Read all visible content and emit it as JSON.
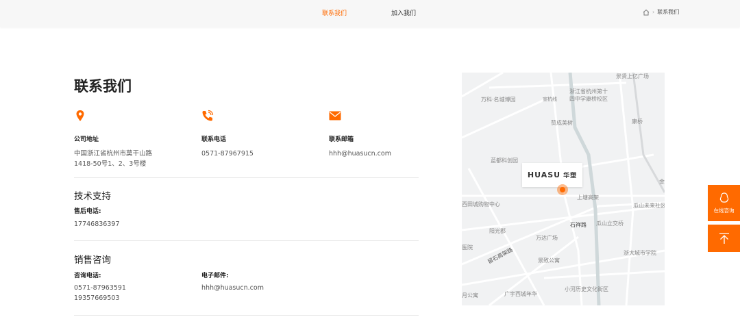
{
  "nav": {
    "tabs": [
      {
        "label": "联系我们",
        "active": true
      },
      {
        "label": "加入我们",
        "active": false
      }
    ],
    "breadcrumb": "联系我们"
  },
  "page_title": "联系我们",
  "contact": [
    {
      "icon": "location-pin-icon",
      "label": "公司地址",
      "lines": [
        "中国浙江省杭州市莫干山路",
        "1418-50号1、2、3号楼"
      ]
    },
    {
      "icon": "phone-icon",
      "label": "联系电话",
      "lines": [
        "0571-87967915"
      ]
    },
    {
      "icon": "mail-icon",
      "label": "联系邮箱",
      "lines": [
        "hhh@huasucn.com"
      ]
    }
  ],
  "support": {
    "title": "技术支持",
    "label": "售后电话:",
    "value": "17746836397"
  },
  "sales": {
    "title": "销售咨询",
    "phone_label": "咨询电话:",
    "phones": [
      "0571-87963591",
      "19357669503"
    ],
    "email_label": "电子邮件:",
    "email": "hhh@huasucn.com"
  },
  "map": {
    "brand": "HUASU",
    "brand_cn": "华塑",
    "labels": [
      "景贤上亿广场",
      "浙江省杭州第十",
      "四中学康桥校区",
      "万科·名城博园",
      "宣杭线",
      "赞成美树",
      "康桥",
      "蓝都科创园",
      "上塘高架",
      "西田城购物中心",
      "瓜山未来社区",
      "石祥路",
      "瓜山立交桥",
      "阳光郡",
      "万达广场",
      "医院",
      "留石高架路",
      "浙大城市学院",
      "景致公寓",
      "月公寓",
      "广宇西城年华",
      "小河历史文化街区",
      "金"
    ]
  },
  "side": {
    "consult_label": "在线咨询"
  },
  "colors": {
    "accent": "#ff6a00"
  }
}
